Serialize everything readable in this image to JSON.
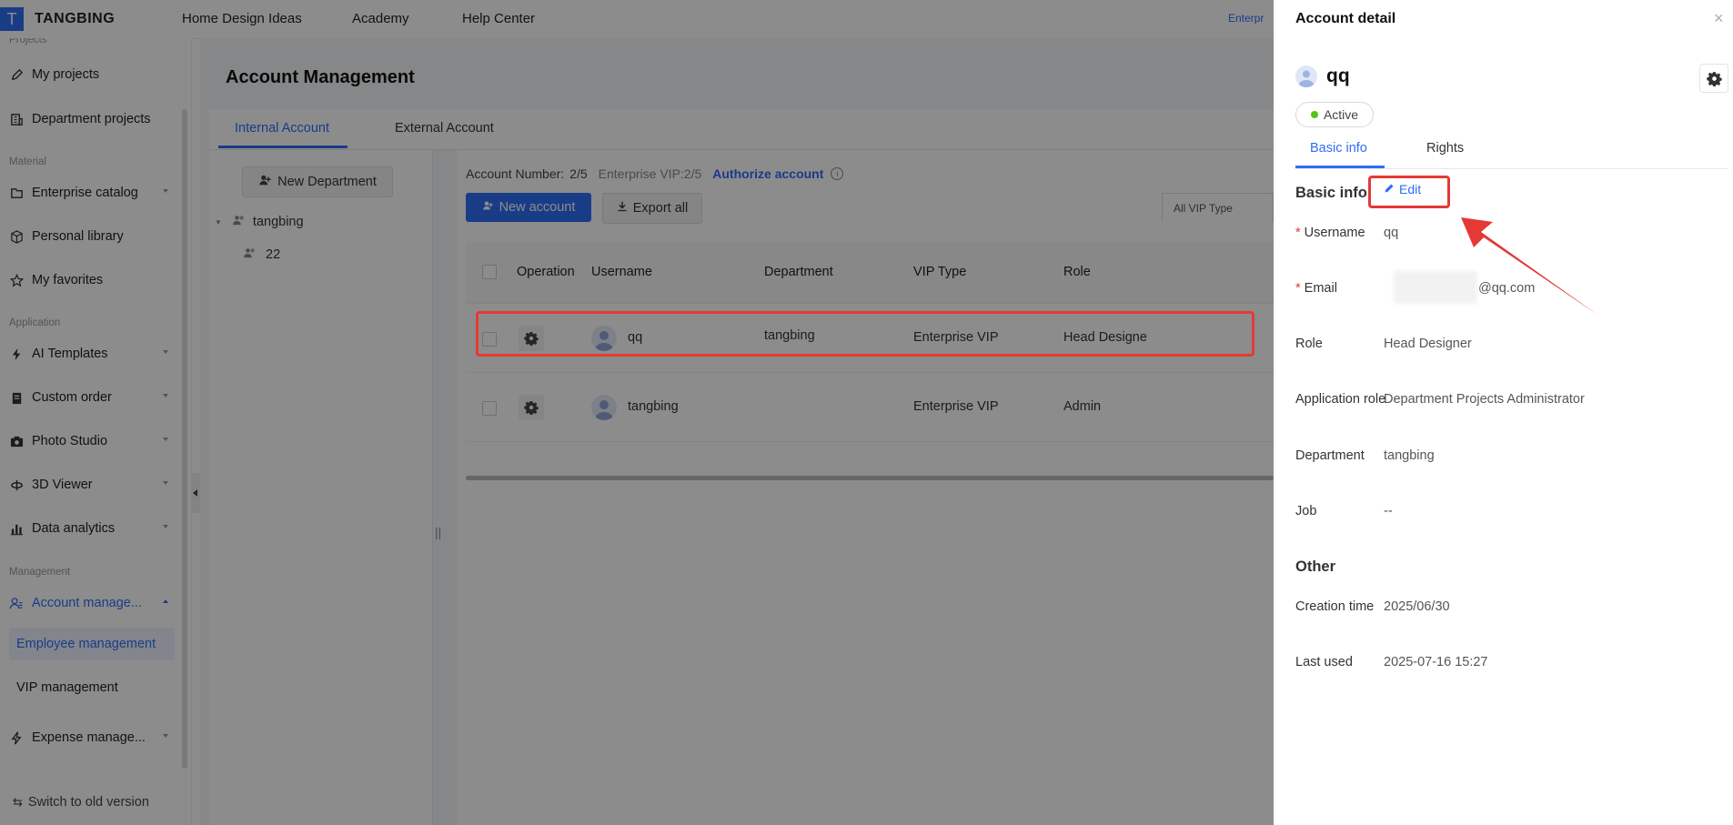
{
  "topbar": {
    "logo_letter": "T",
    "brand": "TANGBING",
    "nav": [
      "Home Design Ideas",
      "Academy",
      "Help Center"
    ],
    "enterprise_tag": "Enterpr"
  },
  "sidebar": {
    "partial_section": "Projects",
    "items": {
      "my_projects": "My projects",
      "department_projects": "Department projects",
      "enterprise_catalog": "Enterprise catalog",
      "personal_library": "Personal library",
      "my_favorites": "My favorites",
      "ai_templates": "AI Templates",
      "custom_order": "Custom order",
      "photo_studio": "Photo Studio",
      "viewer_3d": "3D Viewer",
      "data_analytics": "Data analytics",
      "account_management": "Account manage...",
      "employee_management": "Employee management",
      "vip_management": "VIP management",
      "expense_management": "Expense manage..."
    },
    "sections": {
      "material": "Material",
      "application": "Application",
      "management": "Management"
    },
    "footer": "Switch to old version"
  },
  "main": {
    "title": "Account Management",
    "tabs": [
      "Internal Account",
      "External Account"
    ],
    "new_department": "New Department",
    "tree": {
      "root": "tangbing",
      "child": "22"
    },
    "account_number_label": "Account Number:",
    "account_number_value": "2/5",
    "enterprise_vip": "Enterprise VIP:2/5",
    "authorize_account": "Authorize account",
    "new_account": "New account",
    "export_all": "Export all",
    "vip_filter": "All VIP Type",
    "columns": [
      "Operation",
      "Username",
      "Department",
      "VIP Type",
      "Role"
    ],
    "rows": [
      {
        "username": "qq",
        "department": "tangbing",
        "vip_type": "Enterprise VIP",
        "role": "Head Designe"
      },
      {
        "username": "tangbing",
        "department": "",
        "vip_type": "Enterprise VIP",
        "role": "Admin"
      }
    ]
  },
  "drawer": {
    "title": "Account detail",
    "close": "×",
    "name": "qq",
    "status": "Active",
    "tabs": [
      "Basic info",
      "Rights"
    ],
    "basic_info_title": "Basic info",
    "edit": "Edit",
    "fields": {
      "username": {
        "label": "Username",
        "value": "qq"
      },
      "email": {
        "label": "Email",
        "value": "@qq.com"
      },
      "role": {
        "label": "Role",
        "value": "Head Designer"
      },
      "application_role": {
        "label": "Application role",
        "value": "Department Projects Administrator"
      },
      "department": {
        "label": "Department",
        "value": "tangbing"
      },
      "job": {
        "label": "Job",
        "value": "--"
      }
    },
    "other_title": "Other",
    "other": {
      "creation_time": {
        "label": "Creation time",
        "value": "2025/06/30"
      },
      "last_used": {
        "label": "Last used",
        "value": "2025-07-16 15:27"
      }
    }
  },
  "colors": {
    "accent": "#2f6df6",
    "highlight_red": "#e53935",
    "status_green": "#52c41a"
  }
}
